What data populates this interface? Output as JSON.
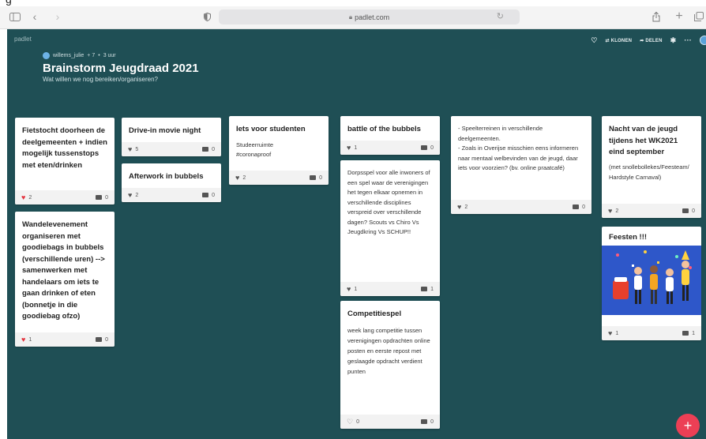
{
  "browser": {
    "url": "padlet.com"
  },
  "board": {
    "brand": "padlet",
    "author": "willems_julie",
    "likes_count": "+ 7",
    "time_ago": "3 uur",
    "title": "Brainstorm Jeugdraad 2021",
    "subtitle": "Wat willen we nog bereiken/organiseren?",
    "actions": {
      "clone": "KLONEN",
      "share": "DELEN"
    }
  },
  "cards": [
    {
      "id": "c1",
      "title": "Fietstocht doorheen de deelgemeenten + indien mogelijk tussenstops met eten/drinken",
      "body": "",
      "likes": "2",
      "comments": "0",
      "liked": true
    },
    {
      "id": "c2",
      "title": "Wandelevenement organiseren met goodiebags in bubbels (verschillende uren) --> samenwerken met handelaars om iets te gaan drinken of eten (bonnetje in die goodiebag ofzo)",
      "body": "",
      "likes": "1",
      "comments": "0",
      "liked": true
    },
    {
      "id": "c3",
      "title": "Drive-in movie night",
      "body": "",
      "likes": "5",
      "comments": "0",
      "liked": false
    },
    {
      "id": "c4",
      "title": "Afterwork in bubbels",
      "body": "",
      "likes": "2",
      "comments": "0",
      "liked": false
    },
    {
      "id": "c5",
      "title": "Iets voor studenten",
      "body": "Studeerruimte #coronaproof",
      "likes": "2",
      "comments": "0",
      "liked": false
    },
    {
      "id": "c6",
      "title": "battle of the bubbels",
      "body": "",
      "likes": "1",
      "comments": "0",
      "liked": false
    },
    {
      "id": "c7",
      "title": "",
      "body": "Dorpsspel voor alle inwoners of een spel waar de verenigingen het tegen elkaar opnemen in verschillende disciplines verspreid over verschillende dagen? Scouts vs Chiro Vs Jeugdkring Vs SCHUP!!",
      "likes": "1",
      "comments": "1",
      "liked": false
    },
    {
      "id": "c8",
      "title": "Competitiespel",
      "body": "week lang competitie tussen verenigingen opdrachten online posten en eerste repost met geslaagde opdracht verdient punten",
      "likes": "0",
      "comments": "0",
      "liked": false
    },
    {
      "id": "c9",
      "title": "",
      "body": "- Speelterreinen in verschillende deelgemeenten.\n- Zoals in Overijse misschien eens informeren naar mentaal welbevinden van de jeugd, daar iets voor voorzien? (bv. online praatcafé)",
      "likes": "2",
      "comments": "0",
      "liked": false
    },
    {
      "id": "c10",
      "title": "Nacht van de jeugd tijdens het WK2021 eind september",
      "body": "(met snollebollekes/Feesteam/ Hardstyle Carnaval)",
      "likes": "2",
      "comments": "0",
      "liked": false
    },
    {
      "id": "c11",
      "title": "Feesten !!!",
      "body": "",
      "likes": "1",
      "comments": "1",
      "liked": false
    }
  ]
}
